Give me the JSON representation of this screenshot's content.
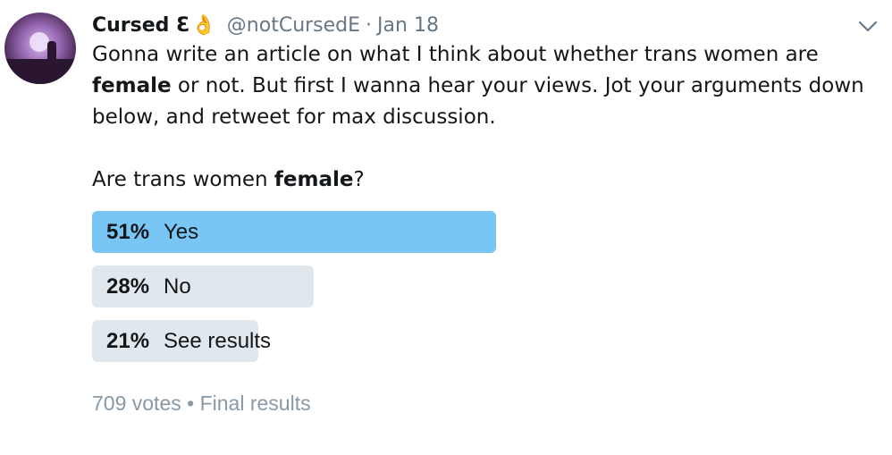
{
  "tweet": {
    "author_name": "Cursed Ɛ",
    "author_emoji": "👌",
    "handle": "@notCursedE",
    "separator": "·",
    "date": "Jan 18",
    "text_part1": "Gonna write an article on what I think about whether trans women are ",
    "text_bold": "female",
    "text_part2": " or not. But first I wanna hear your views. Jot your arguments down below, and retweet for max discussion.",
    "question_part1": "Are trans women ",
    "question_bold": "female",
    "question_part2": "?",
    "menu_icon": "chevron-down-icon"
  },
  "poll": {
    "options": [
      {
        "percent_label": "51%",
        "label": "Yes",
        "percent": 51,
        "winner": true
      },
      {
        "percent_label": "28%",
        "label": "No",
        "percent": 28,
        "winner": false
      },
      {
        "percent_label": "21%",
        "label": "See results",
        "percent": 21,
        "winner": false
      }
    ],
    "votes": "709 votes",
    "separator": "•",
    "status": "Final results"
  },
  "colors": {
    "winner_bar": "#79c6f5",
    "other_bar": "#e1e8ed",
    "muted_text": "#657786"
  }
}
